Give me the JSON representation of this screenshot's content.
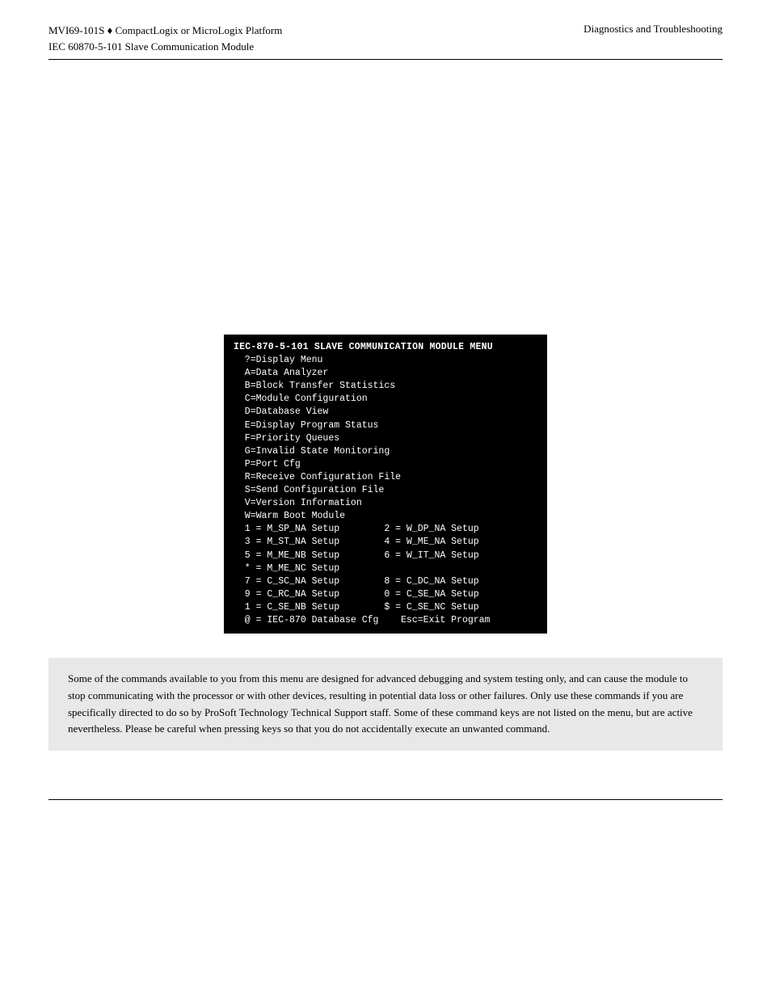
{
  "header": {
    "left_line1": "MVI69-101S ♦ CompactLogix or MicroLogix Platform",
    "left_line2": "IEC 60870-5-101 Slave Communication Module",
    "right": "Diagnostics and Troubleshooting"
  },
  "terminal": {
    "title": "IEC-870-5-101 SLAVE COMMUNICATION MODULE MENU",
    "lines": [
      "  ?=Display Menu",
      "  A=Data Analyzer",
      "  B=Block Transfer Statistics",
      "  C=Module Configuration",
      "  D=Database View",
      "  E=Display Program Status",
      "  F=Priority Queues",
      "  G=Invalid State Monitoring",
      "  P=Port Cfg",
      "  R=Receive Configuration File",
      "  S=Send Configuration File",
      "  V=Version Information",
      "  W=Warm Boot Module",
      "  1 = M_SP_NA Setup        2 = W_DP_NA Setup",
      "  3 = M_ST_NA Setup        4 = W_ME_NA Setup",
      "  5 = M_ME_NB Setup        6 = W_IT_NA Setup",
      "  * = M_ME_NC Setup",
      "  7 = C_SC_NA Setup        8 = C_DC_NA Setup",
      "  9 = C_RC_NA Setup        0 = C_SE_NA Setup",
      "  1 = C_SE_NB Setup        $ = C_SE_NC Setup",
      "  @ = IEC-870 Database Cfg    Esc=Exit Program"
    ]
  },
  "warning": {
    "text": "Some of the commands available to you from this menu are designed for advanced debugging and system testing only, and can cause the module to stop communicating with the processor or with other devices, resulting in potential data loss or other failures. Only use these commands if you are specifically directed to do so by ProSoft Technology Technical Support staff. Some of these command keys are not listed on the menu, but are active nevertheless. Please be careful when pressing keys so that you do not accidentally execute an unwanted command."
  }
}
